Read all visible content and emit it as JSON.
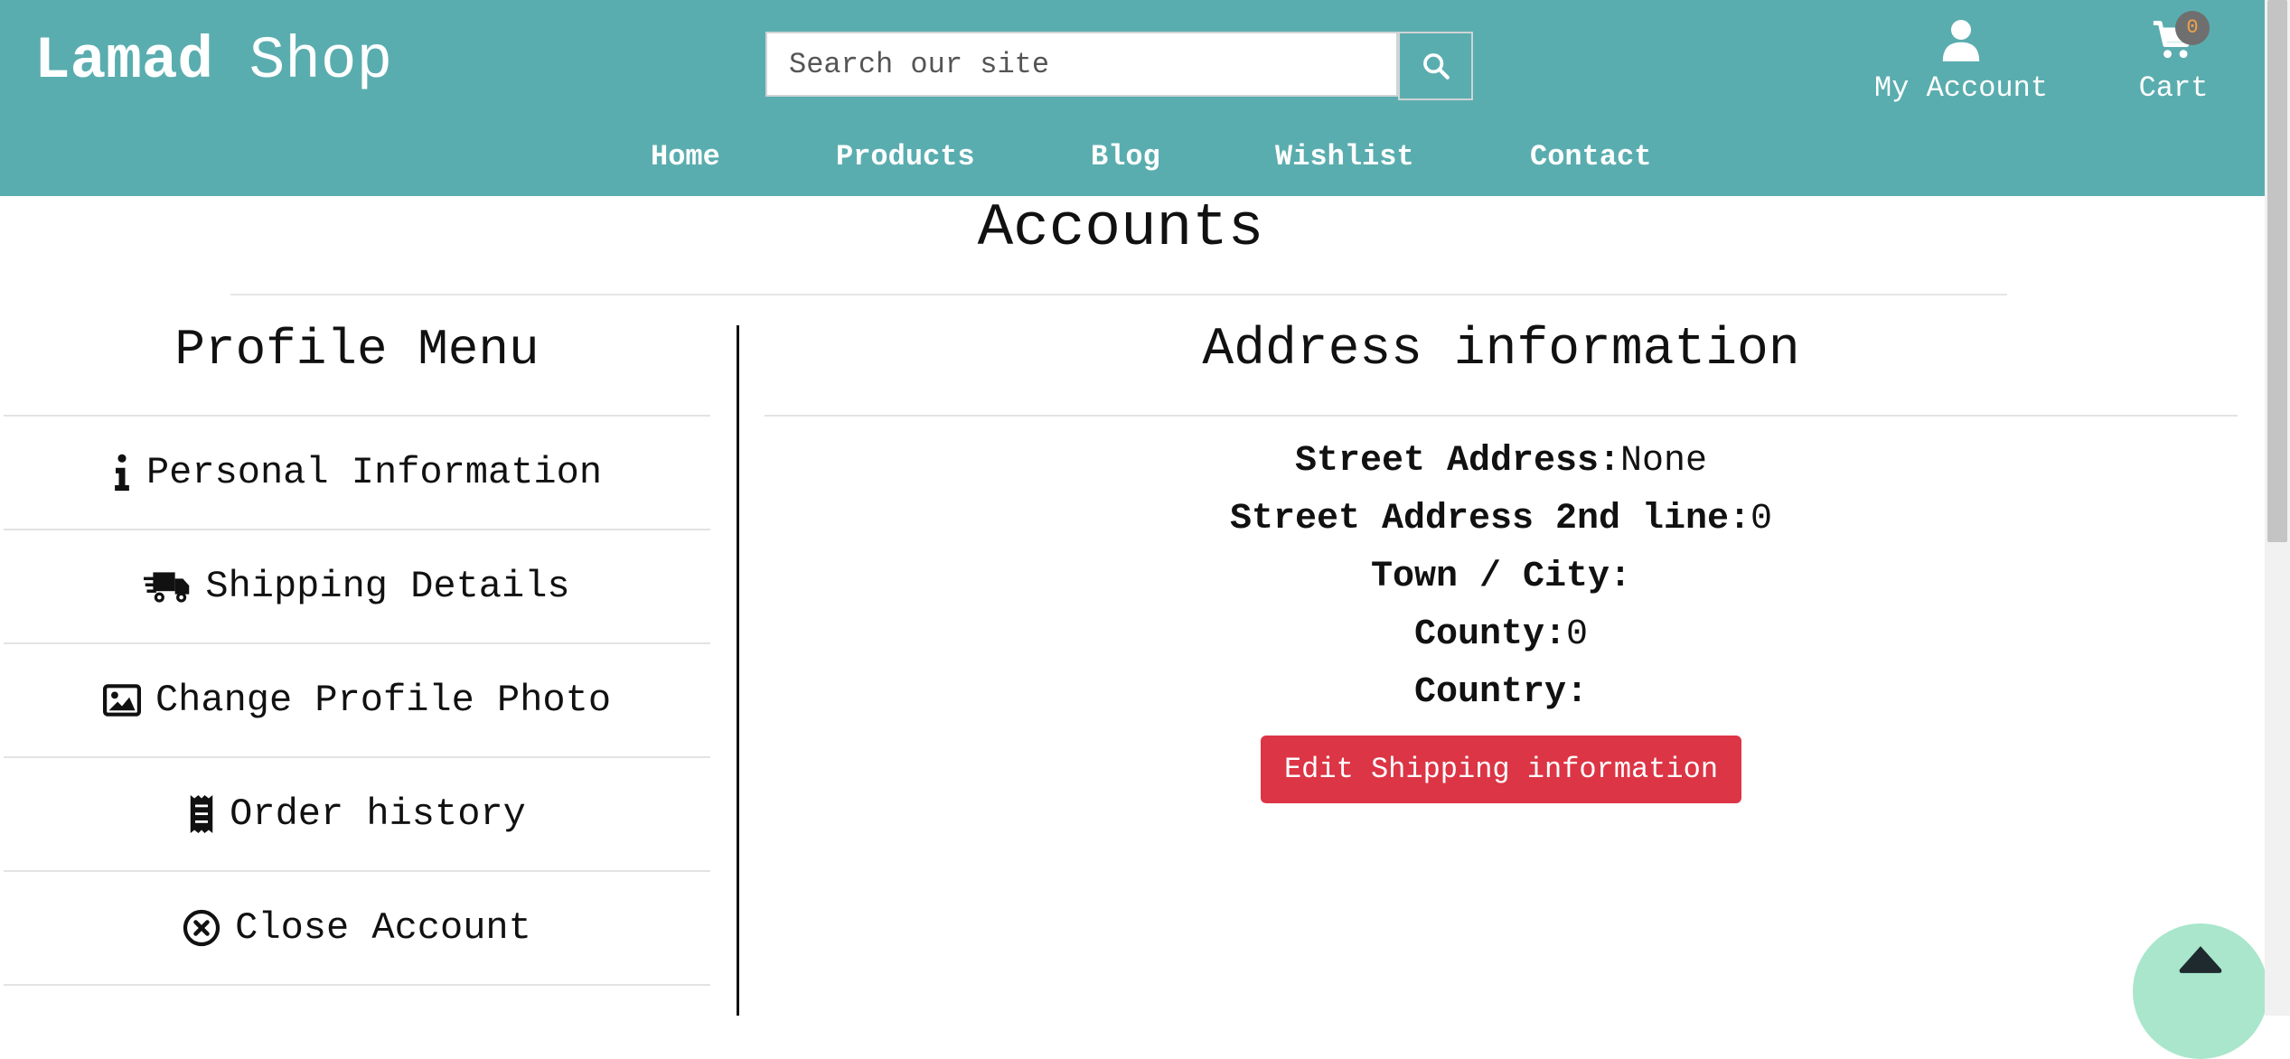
{
  "header": {
    "brand_part1": "Lamad",
    "brand_part2": "Shop",
    "search_placeholder": "Search our site",
    "account_label": "My Account",
    "cart_label": "Cart",
    "cart_count": "0"
  },
  "nav": [
    "Home",
    "Products",
    "Blog",
    "Wishlist",
    "Contact"
  ],
  "page_title": "Accounts",
  "profile_menu": {
    "title": "Profile Menu",
    "items": [
      {
        "label": "Personal Information",
        "icon": "info-icon"
      },
      {
        "label": "Shipping Details",
        "icon": "shipping-fast-icon"
      },
      {
        "label": "Change Profile Photo",
        "icon": "image-icon"
      },
      {
        "label": "Order history",
        "icon": "receipt-icon"
      },
      {
        "label": "Close Account",
        "icon": "close-circle-icon"
      }
    ]
  },
  "address": {
    "title": "Address information",
    "rows": [
      {
        "label": "Street Address:",
        "value": "None"
      },
      {
        "label": "Street Address 2nd line:",
        "value": "0"
      },
      {
        "label": "Town / City:",
        "value": ""
      },
      {
        "label": "County:",
        "value": "0"
      },
      {
        "label": "Country:",
        "value": ""
      }
    ],
    "edit_button": "Edit Shipping information"
  },
  "colors": {
    "header_bg": "#5aadaf",
    "edit_button_bg": "#dc3545",
    "back_to_top_bg": "#a9e6cc"
  }
}
